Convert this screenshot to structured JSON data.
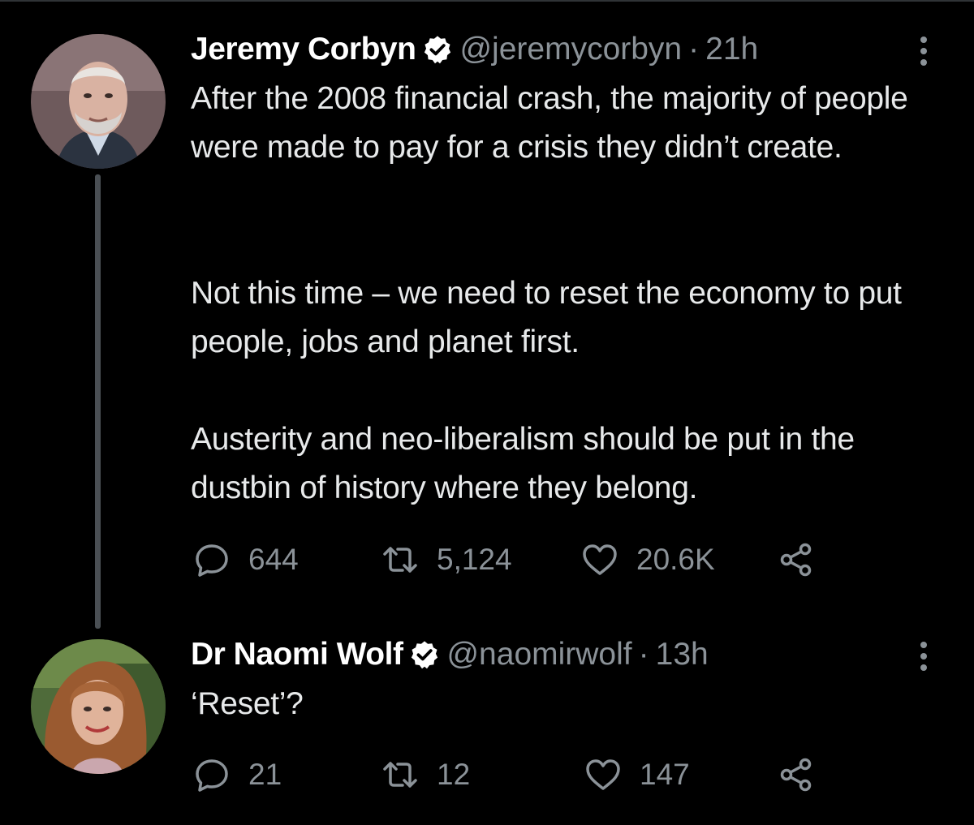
{
  "tweets": [
    {
      "display_name": "Jeremy Corbyn",
      "verified_icon": "verified-badge-icon",
      "handle": "@jeremycorbyn",
      "separator": "·",
      "time": "21h",
      "text_paragraphs": [
        "After the 2008 financial crash, the majority of people were made to pay for a crisis they didn’t create.",
        "Not this time – we need to reset the economy to put people, jobs and planet first.",
        "Austerity and neo-liberalism should be put in the dustbin of history where they belong."
      ],
      "replies": "644",
      "retweets": "5,124",
      "likes": "20.6K"
    },
    {
      "display_name": "Dr Naomi Wolf",
      "verified_icon": "verified-badge-icon",
      "handle": "@naomirwolf",
      "separator": "·",
      "time": "13h",
      "text_paragraphs": [
        "‘Reset’?"
      ],
      "replies": "21",
      "retweets": "12",
      "likes": "147"
    }
  ],
  "colors": {
    "background": "#000000",
    "primary_text": "#e7e9ea",
    "secondary_text": "#8b9298",
    "thread_line": "#4a4f54"
  },
  "icons": {
    "reply": "reply-icon",
    "retweet": "retweet-icon",
    "like": "heart-icon",
    "share": "share-icon",
    "more": "more-vertical-icon"
  }
}
